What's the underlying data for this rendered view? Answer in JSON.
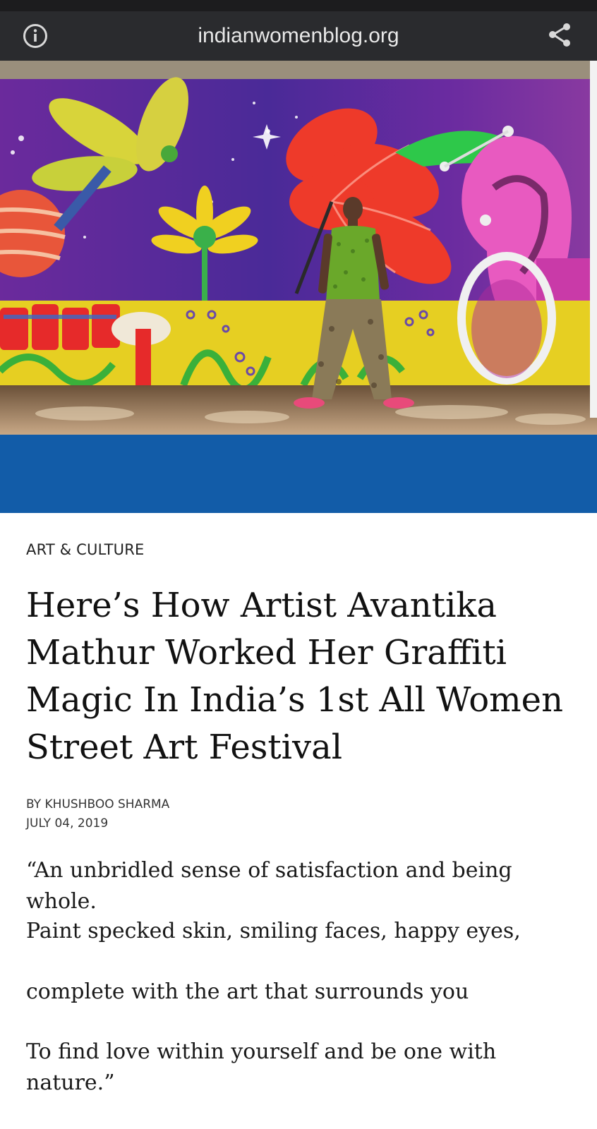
{
  "browser": {
    "url": "indianwomenblog.org",
    "icons": {
      "info": "info-circle-icon",
      "share": "share-icon"
    }
  },
  "hero": {
    "alt_colors": {
      "accent_band": "#125ca8"
    }
  },
  "article": {
    "category": "ART & CULTURE",
    "title": "Here’s How Artist Avantika Mathur Worked Her Graffiti Magic In India’s 1st All Women Street Art Festival",
    "byline": "BY KHUSHBOO SHARMA",
    "date": "JULY 04, 2019",
    "paragraphs": [
      "“An unbridled sense of satisfaction and being whole.",
      "Paint specked skin, smiling faces, happy eyes,",
      "complete with the art that surrounds you",
      "To find love within yourself and be one with nature.”"
    ]
  }
}
